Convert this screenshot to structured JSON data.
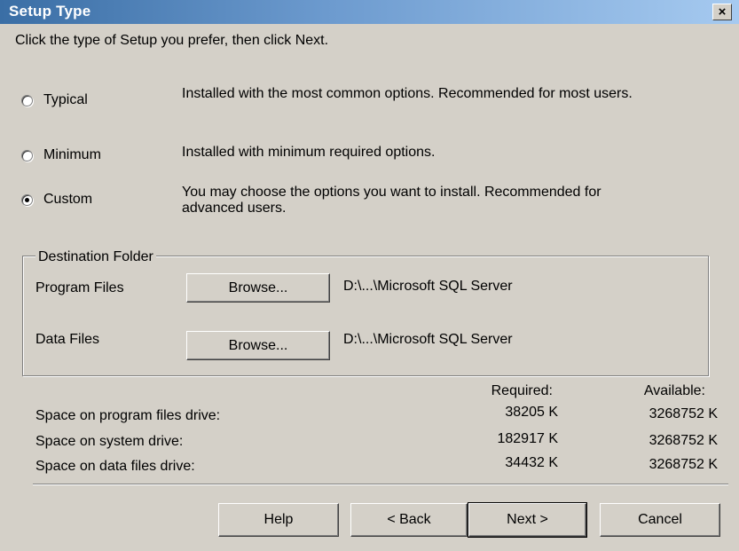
{
  "window": {
    "title": "Setup Type",
    "close_glyph": "×"
  },
  "instruction": "Click the type of Setup you prefer, then click Next.",
  "options": [
    {
      "label": "Typical",
      "description": "Installed with the most common options. Recommended for most users.",
      "checked": false
    },
    {
      "label": "Minimum",
      "description": "Installed with minimum required options.",
      "checked": false
    },
    {
      "label": "Custom",
      "description_line1": "You may choose the options you want to install. Recommended for",
      "description_line2": "advanced users.",
      "checked": true
    }
  ],
  "destination": {
    "legend": "Destination Folder",
    "program_files": {
      "label": "Program Files",
      "button": "Browse...",
      "path": "D:\\...\\Microsoft SQL Server"
    },
    "data_files": {
      "label": "Data Files",
      "button": "Browse...",
      "path": "D:\\...\\Microsoft SQL Server"
    }
  },
  "space": {
    "required_header": "Required:",
    "available_header": "Available:",
    "rows": [
      {
        "label": "Space on program files drive:",
        "required": "38205 K",
        "available": "3268752 K"
      },
      {
        "label": "Space on system drive:",
        "required": "182917 K",
        "available": "3268752 K"
      },
      {
        "label": "Space on data files drive:",
        "required": "34432 K",
        "available": "3268752 K"
      }
    ]
  },
  "buttons": {
    "help": "Help",
    "back": "< Back",
    "next": "Next >",
    "cancel": "Cancel"
  }
}
